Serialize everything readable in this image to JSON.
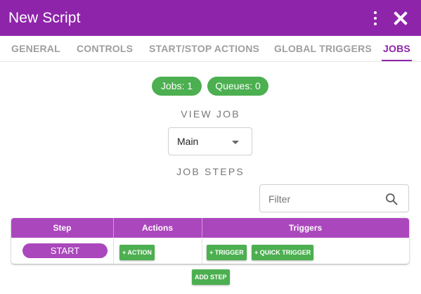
{
  "window": {
    "title": "New Script",
    "menu_icon": "more-vert-icon",
    "close_icon": "close-icon"
  },
  "tabs": [
    {
      "label": "GENERAL",
      "active": false
    },
    {
      "label": "CONTROLS",
      "active": false
    },
    {
      "label": "START/STOP ACTIONS",
      "active": false
    },
    {
      "label": "GLOBAL TRIGGERS",
      "active": false
    },
    {
      "label": "JOBS",
      "active": true
    }
  ],
  "counts": {
    "jobs": "Jobs: 1",
    "queues": "Queues: 0"
  },
  "view_job": {
    "label": "VIEW JOB",
    "selected": "Main"
  },
  "job_steps": {
    "label": "JOB STEPS",
    "filter_placeholder": "Filter",
    "filter_value": "",
    "columns": [
      "Step",
      "Actions",
      "Triggers"
    ],
    "rows": [
      {
        "step": "START",
        "action_button": "+ ACTION",
        "trigger_button": "+ TRIGGER",
        "quick_trigger_button": "+ QUICK TRIGGER"
      }
    ],
    "add_step_button": "ADD STEP"
  },
  "colors": {
    "primary": "#8e24aa",
    "table_header": "#ab47bc",
    "success": "#4caf50"
  }
}
